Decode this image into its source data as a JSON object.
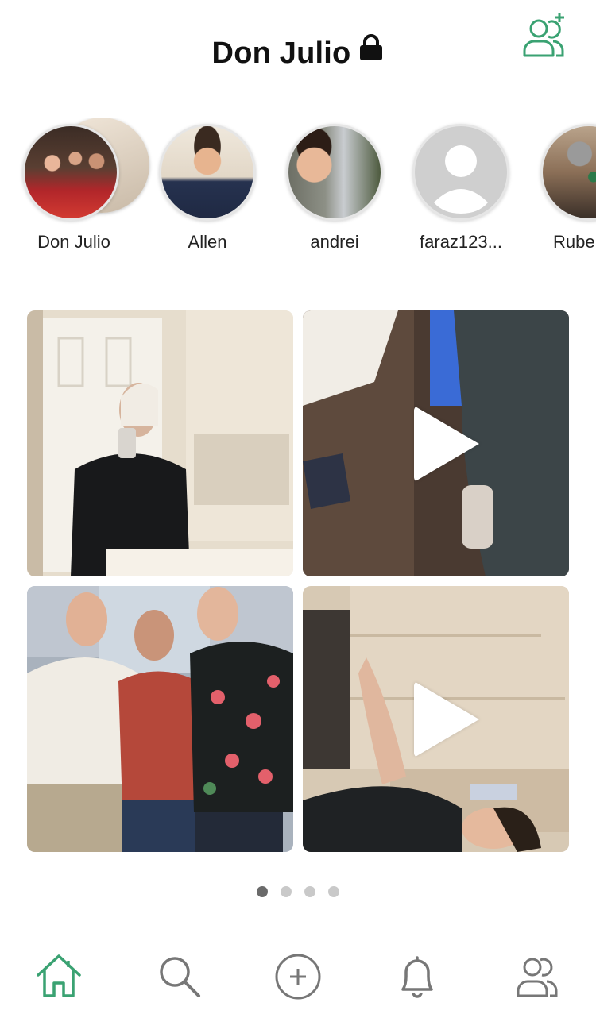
{
  "header": {
    "title": "Don Julio",
    "lock_icon": "lock-icon",
    "add_friend_icon": "add-friend-icon"
  },
  "stories": [
    {
      "label": "Don Julio"
    },
    {
      "label": "Allen"
    },
    {
      "label": "andrei"
    },
    {
      "label": "faraz123..."
    },
    {
      "label": "Rube"
    }
  ],
  "grid": {
    "tiles": [
      {
        "type": "photo"
      },
      {
        "type": "video"
      },
      {
        "type": "photo"
      },
      {
        "type": "video"
      }
    ]
  },
  "pager": {
    "count": 4,
    "active_index": 0
  },
  "tabbar": {
    "items": [
      {
        "icon": "home-icon",
        "active": true
      },
      {
        "icon": "search-icon",
        "active": false
      },
      {
        "icon": "add-post-icon",
        "active": false
      },
      {
        "icon": "bell-icon",
        "active": false
      },
      {
        "icon": "friends-icon",
        "active": false
      }
    ]
  },
  "colors": {
    "accent": "#3aa272",
    "icon_gray": "#777777",
    "dot_active": "#6a6a6a",
    "dot_inactive": "#c9c9c9"
  }
}
